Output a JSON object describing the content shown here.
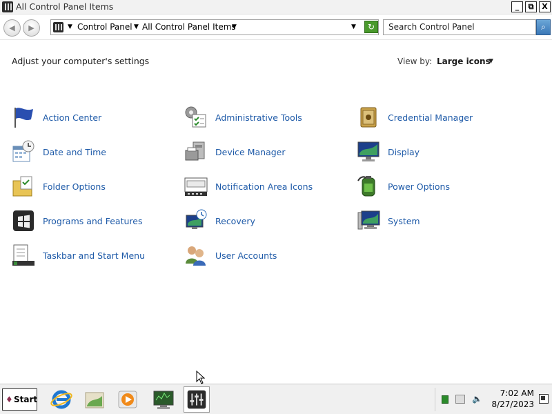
{
  "window": {
    "title": "All Control Panel Items"
  },
  "titlebar_buttons": {
    "minimize": "_",
    "restore": "⧉",
    "close": "X"
  },
  "address": {
    "crumbs": [
      "Control Panel",
      "All Control Panel Items"
    ],
    "search_placeholder": "Search Control Panel"
  },
  "content": {
    "heading": "Adjust your computer's settings",
    "view_by_label": "View by:",
    "view_by_value": "Large icons"
  },
  "items": [
    {
      "label": "Action Center",
      "icon": "flag-icon"
    },
    {
      "label": "Administrative Tools",
      "icon": "gears-checklist-icon"
    },
    {
      "label": "Credential Manager",
      "icon": "safe-icon"
    },
    {
      "label": "Date and Time",
      "icon": "calendar-clock-icon"
    },
    {
      "label": "Device Manager",
      "icon": "printer-device-icon"
    },
    {
      "label": "Display",
      "icon": "monitor-icon"
    },
    {
      "label": "Folder Options",
      "icon": "folder-check-icon"
    },
    {
      "label": "Notification Area Icons",
      "icon": "notification-bar-icon"
    },
    {
      "label": "Power Options",
      "icon": "battery-icon"
    },
    {
      "label": "Programs and Features",
      "icon": "windows-box-icon"
    },
    {
      "label": "Recovery",
      "icon": "recovery-monitor-icon"
    },
    {
      "label": "System",
      "icon": "system-monitor-icon"
    },
    {
      "label": "Taskbar and Start Menu",
      "icon": "taskbar-icon"
    },
    {
      "label": "User Accounts",
      "icon": "users-icon"
    }
  ],
  "taskbar": {
    "start_label": "Start",
    "apps": [
      "internet-explorer-icon",
      "explorer-icon",
      "media-player-icon",
      "monitor-app-icon",
      "control-panel-icon"
    ],
    "time": "7:02 AM",
    "date": "8/27/2023"
  },
  "colors": {
    "link": "#1e5aa8",
    "accent": "#3a78b8"
  }
}
